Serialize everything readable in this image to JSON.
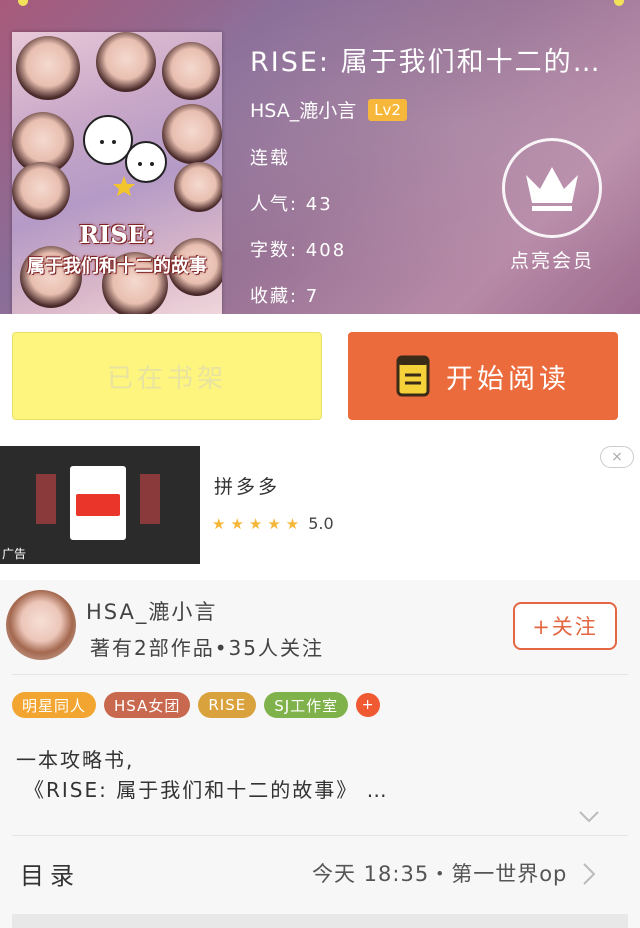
{
  "book": {
    "title": "RISE: 属于我们和十二的…",
    "author": "HSA_漉小言",
    "level": "Lv2",
    "status": "连载",
    "popularity": "人气: 43",
    "word_count": "字数: 408",
    "favorites": "收藏: 7",
    "cover_title_line1": "RISE:",
    "cover_title_line2": "属于我们和十二的故事"
  },
  "vip": {
    "label": "点亮会员",
    "icon": "crown-icon"
  },
  "actions": {
    "shelf_label": "已在书架",
    "read_label": "开始阅读"
  },
  "ad": {
    "name": "拼多多",
    "stars": "★★★★★",
    "rating": "5.0",
    "tag": "广告",
    "close_icon": "×"
  },
  "author_card": {
    "name": "HSA_漉小言",
    "summary": "著有2部作品•35人关注",
    "follow_label": "+关注"
  },
  "tags": [
    {
      "label": "明星同人",
      "color": "#f3a531"
    },
    {
      "label": "HSA女团",
      "color": "#c8694f"
    },
    {
      "label": "RISE",
      "color": "#d9a23c"
    },
    {
      "label": "SJ工作室",
      "color": "#7fb24a"
    },
    {
      "label": "+",
      "color": "#ef5a33"
    }
  ],
  "description": {
    "line1": "一本攻略书,",
    "line2": "《RISE: 属于我们和十二的故事》 …"
  },
  "toc": {
    "label": "目录",
    "latest": "今天 18:35・第一世界op"
  }
}
